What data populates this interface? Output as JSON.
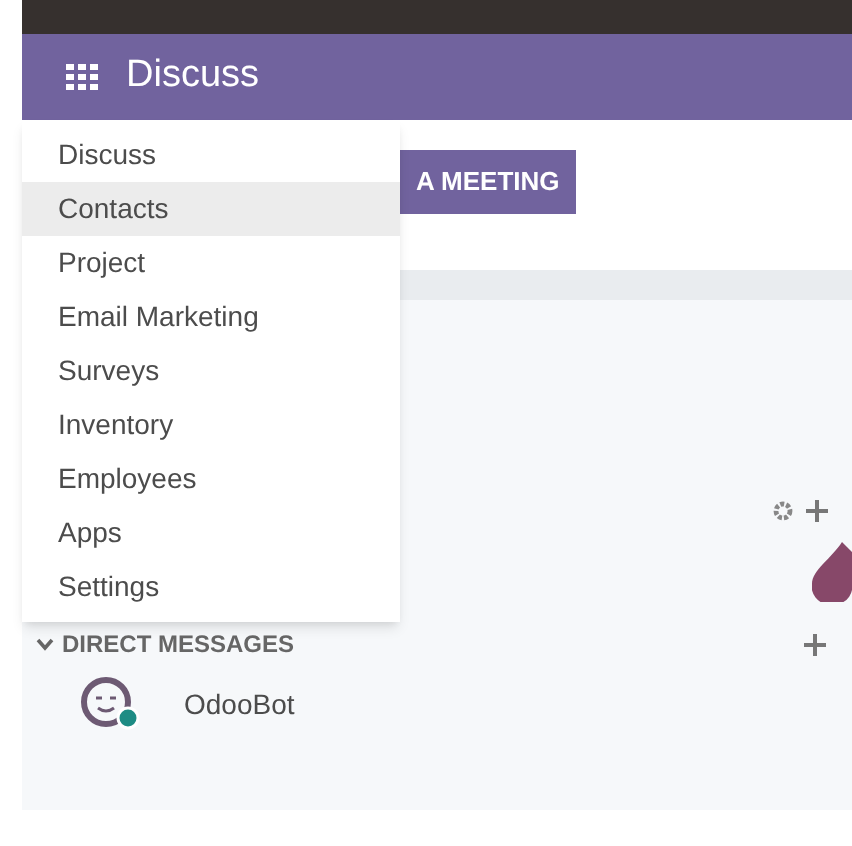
{
  "navbar": {
    "title": "Discuss"
  },
  "app_menu": {
    "items": [
      {
        "label": "Discuss",
        "selected": false
      },
      {
        "label": "Contacts",
        "selected": true
      },
      {
        "label": "Project",
        "selected": false
      },
      {
        "label": "Email Marketing",
        "selected": false
      },
      {
        "label": "Surveys",
        "selected": false
      },
      {
        "label": "Inventory",
        "selected": false
      },
      {
        "label": "Employees",
        "selected": false
      },
      {
        "label": "Apps",
        "selected": false
      },
      {
        "label": "Settings",
        "selected": false
      }
    ]
  },
  "meeting_button": {
    "label": "A MEETING"
  },
  "direct_messages": {
    "title": "DIRECT MESSAGES",
    "expanded": true,
    "items": [
      {
        "name": "OdooBot"
      }
    ]
  }
}
